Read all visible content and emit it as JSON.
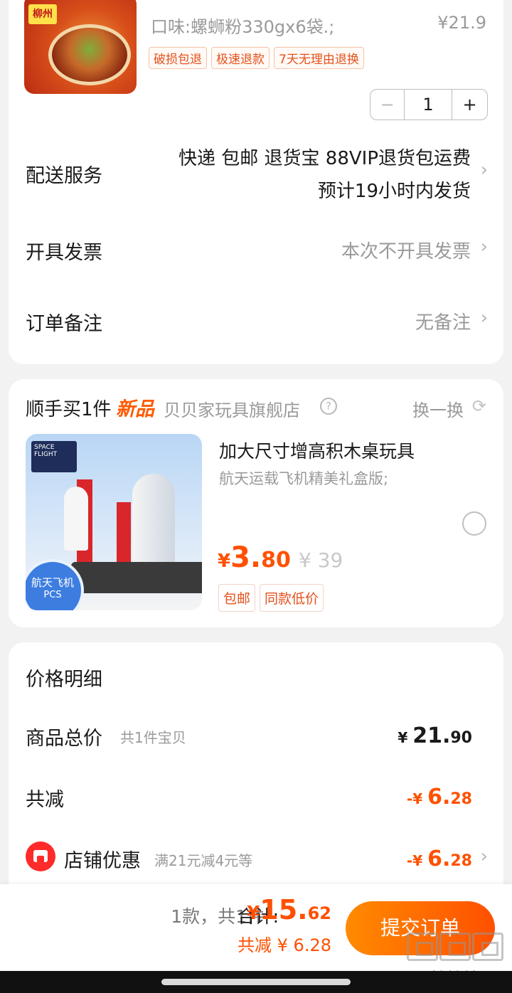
{
  "product": {
    "sku_text": "口味:螺蛳粉330gx6袋.;",
    "price_text": "¥21.9",
    "package_label": "柳州",
    "tags": [
      "破损包退",
      "极速退款",
      "7天无理由退换"
    ],
    "quantity": "1",
    "minus": "−",
    "plus": "+"
  },
  "delivery": {
    "label": "配送服务",
    "line1": "快递 包邮 退货宝 88VIP退货包运费",
    "line2": "预计19小时内发货"
  },
  "invoice": {
    "label": "开具发票",
    "value": "本次不开具发票"
  },
  "remark": {
    "label": "订单备注",
    "value": "无备注"
  },
  "addon": {
    "title": "顺手买1件",
    "new_badge": "新品",
    "shop": "贝贝家玩具旗舰店",
    "help": "?",
    "swap": "换一换",
    "refresh": "⟳",
    "name": "加大尺寸增高积木桌玩具",
    "desc": "航天运载飞机精美礼盒版;",
    "price_symbol": "¥",
    "price_int": "3.",
    "price_dec": "80",
    "orig_price": "¥ 39",
    "tags": [
      "包邮",
      "同款低价"
    ],
    "image_box_text": "SPACE FLIGHT",
    "image_badge_line1": "航天飞机",
    "image_badge_line2": "PCS"
  },
  "price_detail": {
    "title": "价格明细",
    "goods_total_label": "商品总价",
    "goods_total_sub": "共1件宝贝",
    "goods_total_sym": "¥ ",
    "goods_total_int": "21.",
    "goods_total_dec": "90",
    "reduce_label": "共减",
    "reduce_sym": "-¥ ",
    "reduce_int": "6.",
    "reduce_dec": "28",
    "shop_discount_label": "店铺优惠",
    "shop_discount_sub": "满21元减4元等",
    "shop_discount_sym": "-¥ ",
    "shop_discount_int": "6.",
    "shop_discount_dec": "28"
  },
  "bottom_bar": {
    "count": "1款，共1件",
    "total_label": "合计:",
    "total_sym": "¥",
    "total_int": "15.",
    "total_dec": "62",
    "saved": "共减 ¥ 6.28",
    "submit": "提交订单",
    "watermark": "zhizhizhi.com"
  },
  "icons": {
    "chevron": "›"
  },
  "colors": {
    "accent": "#ff5000",
    "submit_start": "#ff8a00",
    "submit_end": "#ff5000",
    "background": "#f2f2f2"
  }
}
